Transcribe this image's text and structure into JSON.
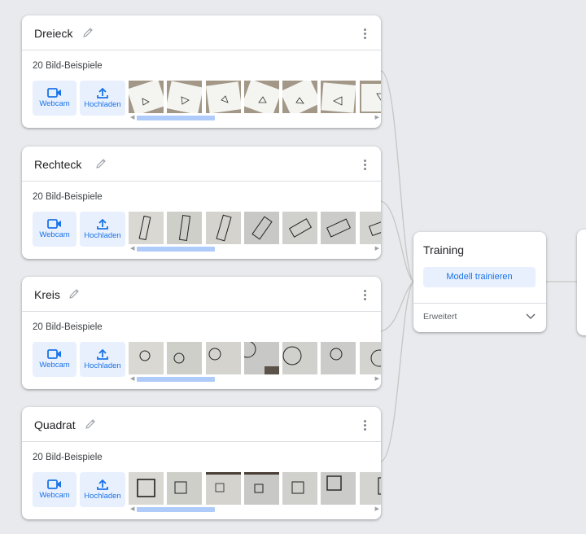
{
  "classes": [
    {
      "name": "Dreieck",
      "sample_count": "20 Bild-Beispiele",
      "webcam_label": "Webcam",
      "upload_label": "Hochladen",
      "shape": "triangle"
    },
    {
      "name": "Rechteck",
      "sample_count": "20 Bild-Beispiele",
      "webcam_label": "Webcam",
      "upload_label": "Hochladen",
      "shape": "rectangle"
    },
    {
      "name": "Kreis",
      "sample_count": "20 Bild-Beispiele",
      "webcam_label": "Webcam",
      "upload_label": "Hochladen",
      "shape": "circle"
    },
    {
      "name": "Quadrat",
      "sample_count": "20 Bild-Beispiele",
      "webcam_label": "Webcam",
      "upload_label": "Hochladen",
      "shape": "square"
    }
  ],
  "training": {
    "title": "Training",
    "train_button": "Modell trainieren",
    "advanced_label": "Erweitert"
  },
  "icons": {
    "edit": "pencil-icon",
    "more": "more-vert-icon",
    "webcam": "videocam-icon",
    "upload": "upload-icon",
    "expand": "chevron-down-icon"
  },
  "colors": {
    "accent": "#1a73e8",
    "accent_bg": "#e8f0fe",
    "scrollbar": "#aecbfa",
    "background": "#e8eaed"
  }
}
